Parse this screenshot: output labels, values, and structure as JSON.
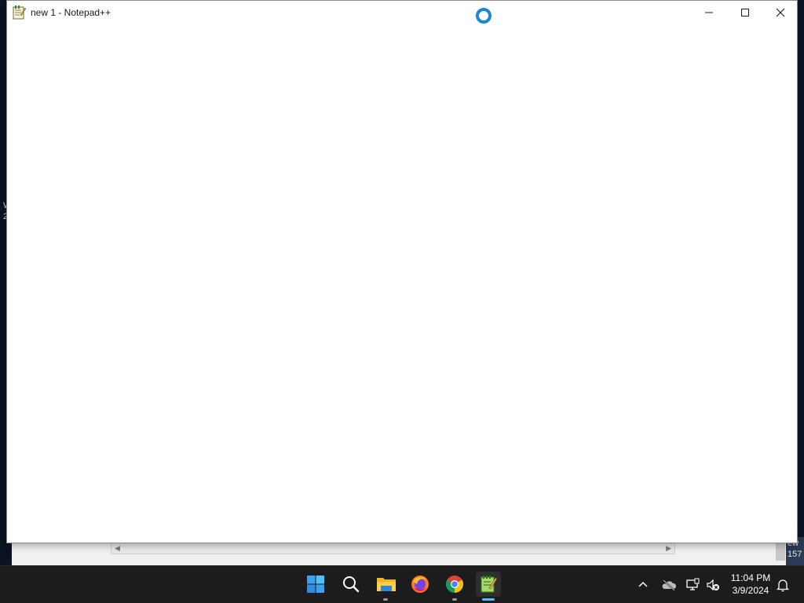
{
  "desktop": {
    "left_fragment_1": "W",
    "left_fragment_2": "2",
    "right_fragment_1": "ew",
    "right_fragment_2": "157"
  },
  "notepad": {
    "title": "new 1 - Notepad++",
    "editor_text": ""
  },
  "taskbar": {
    "apps": [
      "start",
      "search",
      "file-explorer",
      "firefox",
      "chrome",
      "notepad-plus-plus"
    ],
    "active_app": "notepad-plus-plus"
  },
  "clock": {
    "time": "11:04 PM",
    "date": "3/9/2024"
  },
  "colors": {
    "accent": "#4cc2ff",
    "taskbar_bg": "#1c1c1c"
  }
}
